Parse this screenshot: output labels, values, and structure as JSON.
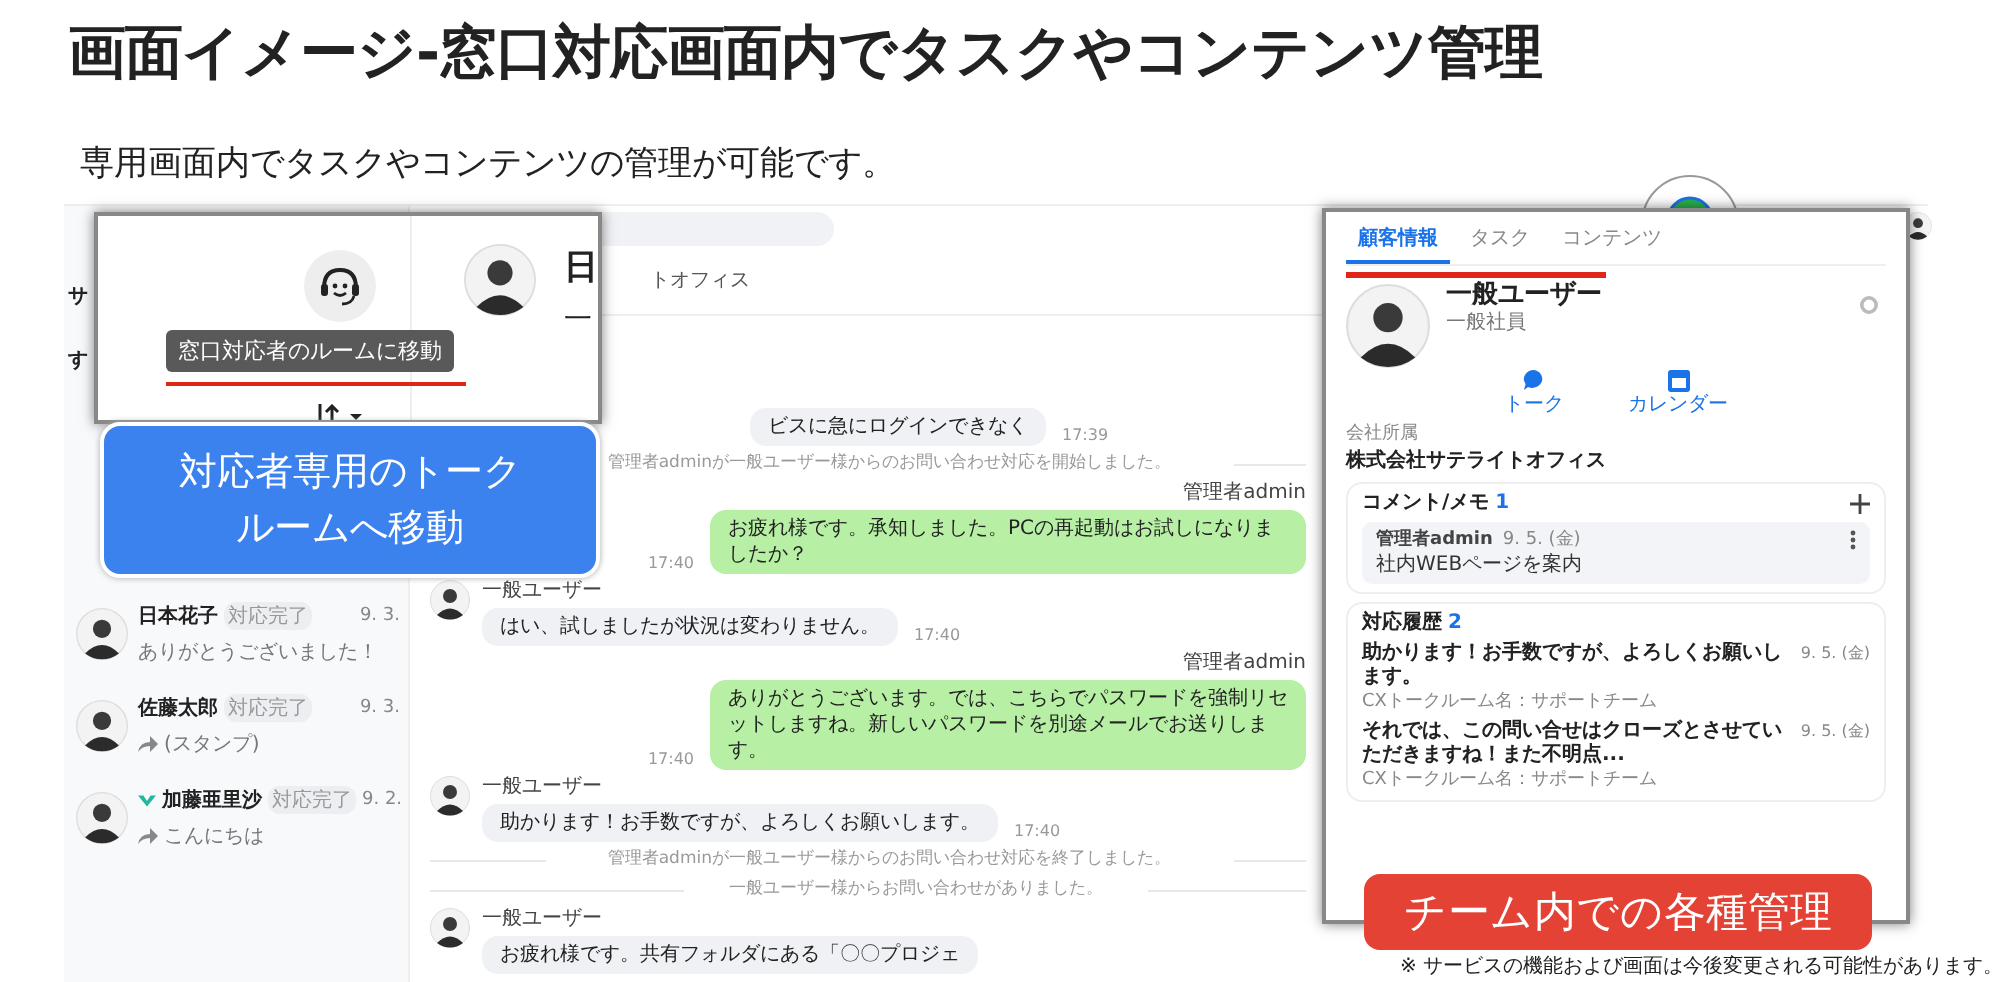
{
  "title": "画面イメージ-窓口対応画面内でタスクやコンテンツ管理",
  "subtitle": "専用画面内でタスクやコンテンツの管理が可能です。",
  "sidebar": {
    "fragments": [
      "サ",
      "す"
    ],
    "items": [
      {
        "name": "日本花子",
        "status": "対応完了",
        "date": "9. 3.",
        "preview": "ありがとうございました！",
        "forwarded": false,
        "app_icon": false
      },
      {
        "name": "佐藤太郎",
        "status": "対応完了",
        "date": "9. 3.",
        "preview": "(スタンプ)",
        "forwarded": true,
        "app_icon": false
      },
      {
        "name": "加藤亜里沙",
        "status": "対応完了",
        "date": "9. 2.",
        "preview": "こんにちは",
        "forwarded": true,
        "app_icon": true
      }
    ]
  },
  "chat": {
    "header_fragment": "トオフィス",
    "messages": [
      {
        "kind": "fragment",
        "text": "ビスに急にログインできなく",
        "time": "17:39"
      },
      {
        "kind": "system",
        "text": "管理者adminが一般ユーザー様からのお問い合わせ対応を開始しました。"
      },
      {
        "kind": "outgoing",
        "sender": "管理者admin",
        "text": "お疲れ様です。承知しました。PCの再起動はお試しになりましたか？",
        "time": "17:40"
      },
      {
        "kind": "incoming",
        "sender": "一般ユーザー",
        "text": "はい、試しましたが状況は変わりません。",
        "time": "17:40"
      },
      {
        "kind": "outgoing",
        "sender": "管理者admin",
        "text": "ありがとうございます。では、こちらでパスワードを強制リセットしますね。新しいパスワードを別途メールでお送りします。",
        "time": "17:40"
      },
      {
        "kind": "incoming",
        "sender": "一般ユーザー",
        "text": "助かります！お手数ですが、よろしくお願いします。",
        "time": "17:40"
      },
      {
        "kind": "system",
        "text": "管理者adminが一般ユーザー様からのお問い合わせ対応を終了しました。"
      },
      {
        "kind": "system",
        "text": "一般ユーザー様からお問い合わせがありました。"
      },
      {
        "kind": "incoming",
        "sender": "一般ユーザー",
        "text": "お疲れ様です。共有フォルダにある「〇〇プロジェ"
      }
    ]
  },
  "popup": {
    "title_fragment": "日",
    "subtitle_fragment": "一",
    "tooltip": "窓口対応者のルームに移動"
  },
  "callout_left": [
    "対応者専用のトーク",
    "ルームへ移動"
  ],
  "panel": {
    "tabs": [
      {
        "label": "顧客情報",
        "selected": true
      },
      {
        "label": "タスク",
        "selected": false
      },
      {
        "label": "コンテンツ",
        "selected": false
      }
    ],
    "name": "一般ユーザー",
    "role": "一般社員",
    "actions": [
      {
        "kind": "talk",
        "label": "トーク"
      },
      {
        "kind": "calendar",
        "label": "カレンダー"
      }
    ],
    "company_label": "会社所属",
    "company": "株式会社サテライトオフィス",
    "memo": {
      "title": "コメント/メモ",
      "count": "1",
      "items": [
        {
          "author": "管理者admin",
          "date": "9. 5. (金)",
          "text": "社内WEBページを案内"
        }
      ]
    },
    "history": {
      "title": "対応履歴",
      "count": "2",
      "items": [
        {
          "text": "助かります！お手数ですが、よろしくお願いします。",
          "date": "9. 5. (金)",
          "room": "CXトークルーム名：サポートチーム"
        },
        {
          "text": "それでは、この問い合せはクローズとさせていただきますね！また不明点...",
          "date": "9. 5. (金)",
          "room": "CXトークルーム名：サポートチーム"
        }
      ]
    }
  },
  "callout_right": "チーム内での各種管理",
  "footnote": "※ サービスの機能および画面は今後変更される可能性があります。"
}
